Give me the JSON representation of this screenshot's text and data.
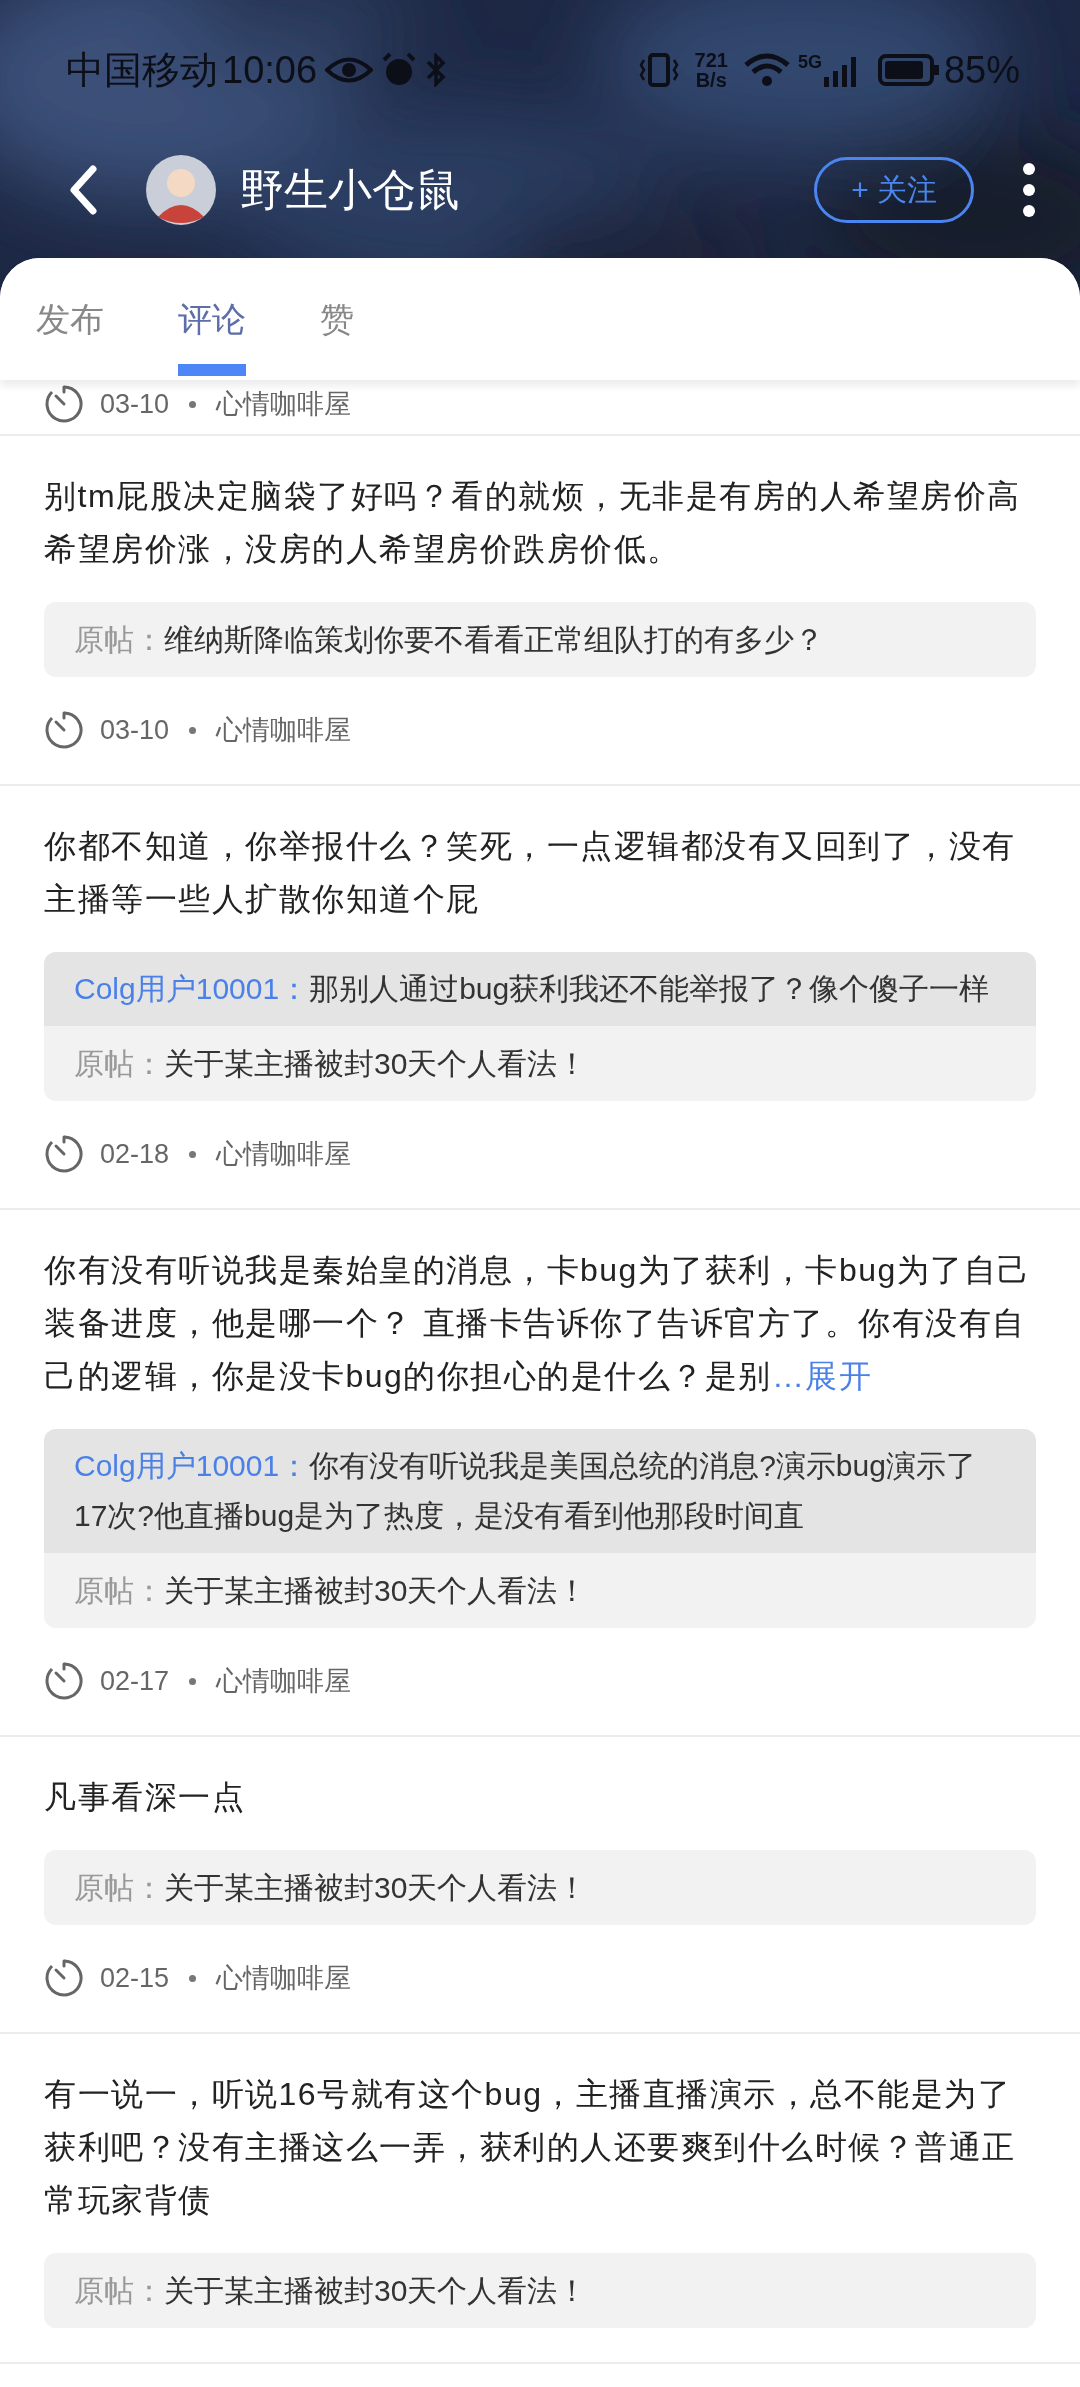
{
  "status_bar": {
    "carrier": "中国移动",
    "time": "10:06",
    "speed_value": "721",
    "speed_unit": "B/s",
    "network_type": "5G",
    "battery": "85%"
  },
  "header": {
    "title": "野生小仓鼠",
    "follow_button": "+ 关注"
  },
  "tabs": [
    {
      "label": "发布",
      "selected": false
    },
    {
      "label": "评论",
      "selected": true
    },
    {
      "label": "赞",
      "selected": false
    }
  ],
  "comments": [
    {
      "kind": "cut",
      "date": "03-10",
      "forum": "心情咖啡屋"
    },
    {
      "kind": "full",
      "text": "别tm屁股决定脑袋了好吗？看的就烦，无非是有房的人希望房价高希望房价涨，没房的人希望房价跌房价低。",
      "original_label": "原帖：",
      "original_title": "维纳斯降临策划你要不看看正常组队打的有多少？",
      "date": "03-10",
      "forum": "心情咖啡屋"
    },
    {
      "kind": "full",
      "text": "你都不知道，你举报什么？笑死，一点逻辑都没有又回到了，没有主播等一些人扩散你知道个屁",
      "reply": {
        "user": "Colg用户10001：",
        "text": "那别人通过bug获利我还不能举报了？像个傻子一样"
      },
      "original_label": "原帖：",
      "original_title": "关于某主播被封30天个人看法！",
      "date": "02-18",
      "forum": "心情咖啡屋"
    },
    {
      "kind": "full",
      "text": "你有没有听说我是秦始皇的消息，卡bug为了获利，卡bug为了自己装备进度，他是哪一个？ 直播卡告诉你了告诉官方了。你有没有自己的逻辑，你是没卡bug的你担心的是什么？是别",
      "expand": "…展开",
      "reply": {
        "user": "Colg用户10001：",
        "text": "你有没有听说我是美国总统的消息?演示bug演示了17次?他直播bug是为了热度，是没有看到他那段时间直"
      },
      "original_label": "原帖：",
      "original_title": "关于某主播被封30天个人看法！",
      "date": "02-17",
      "forum": "心情咖啡屋"
    },
    {
      "kind": "full",
      "text": "凡事看深一点",
      "original_label": "原帖：",
      "original_title": "关于某主播被封30天个人看法！",
      "date": "02-15",
      "forum": "心情咖啡屋"
    },
    {
      "kind": "full",
      "text": "有一说一，听说16号就有这个bug，主播直播演示，总不能是为了获利吧？没有主播这么一弄，获利的人还要爽到什么时候？普通正常玩家背债",
      "original_label": "原帖：",
      "original_title": "关于某主播被封30天个人看法！"
    }
  ]
}
